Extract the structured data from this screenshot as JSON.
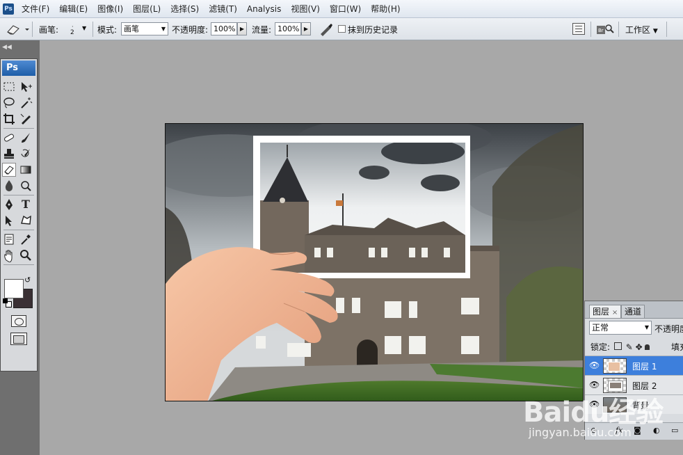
{
  "app_icon": "Ps",
  "menu": [
    "文件(F)",
    "编辑(E)",
    "图像(I)",
    "图层(L)",
    "选择(S)",
    "滤镜(T)",
    "Analysis",
    "视图(V)",
    "窗口(W)",
    "帮助(H)"
  ],
  "options": {
    "brush_label": "画笔:",
    "brush_size": "2",
    "mode_label": "模式:",
    "mode_value": "画笔",
    "opacity_label": "不透明度:",
    "opacity_value": "100%",
    "flow_label": "流量:",
    "flow_value": "100%",
    "erase_history_label": "抹到历史记录",
    "workspace_label": "工作区"
  },
  "toolbox": {
    "header": "Ps",
    "text_tool_glyph": "T",
    "foreground_color": "#ffffff",
    "background_color": "#3a3034"
  },
  "layers_panel": {
    "tabs": [
      "图层",
      "通道"
    ],
    "blend_mode": "正常",
    "opacity_label": "不透明度",
    "lock_label": "锁定:",
    "fill_label": "填充",
    "layers": [
      {
        "name": "图层 1",
        "selected": true
      },
      {
        "name": "图层 2",
        "selected": false
      },
      {
        "name": "背景",
        "selected": false
      }
    ]
  },
  "watermark": {
    "logo": "Baidu经验",
    "url": "jingyan.baidu.com"
  },
  "colors": {
    "accent": "#3d7fdc",
    "canvas_bg": "#a8a8a8"
  }
}
